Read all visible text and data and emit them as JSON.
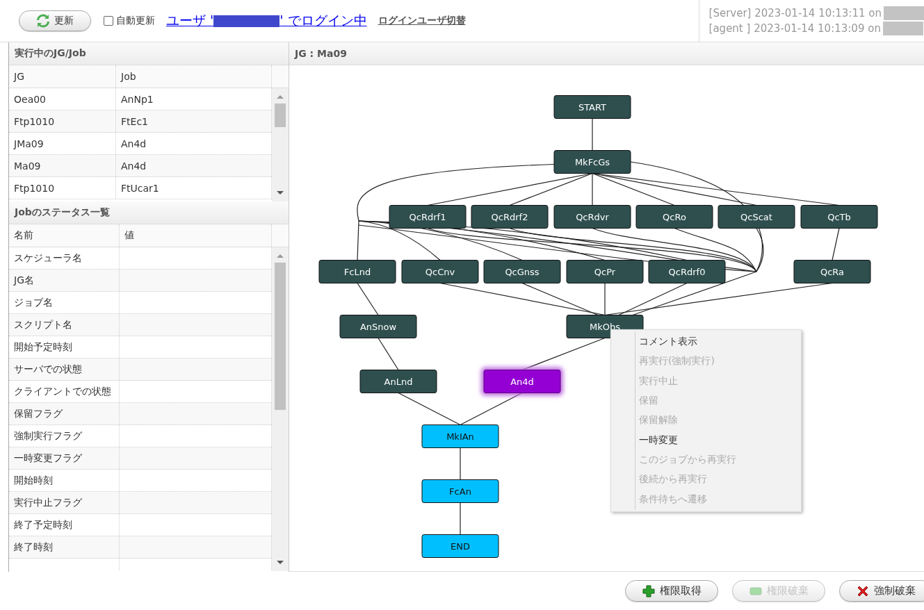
{
  "toolbar": {
    "refresh_button": "更新",
    "auto_refresh": {
      "label": "自動更新",
      "checked": false
    },
    "login_prefix": "ユーザ '",
    "login_suffix": "' でログイン中",
    "switch_user_link": "ログインユーザ切替",
    "server_status": "[Server] 2023-01-14 10:13:11 on",
    "agent_status": "[agent ] 2023-01-14 10:13:09 on"
  },
  "running_panel": {
    "title": "実行中のJG/Job",
    "columns": [
      "JG",
      "Job"
    ],
    "rows": [
      [
        "Oea00",
        "AnNp1"
      ],
      [
        "Ftp1010",
        "FtEc1"
      ],
      [
        "JMa09",
        "An4d"
      ],
      [
        "Ma09",
        "An4d"
      ],
      [
        "Ftp1010",
        "FtUcar1"
      ]
    ]
  },
  "status_panel": {
    "title": "Jobのステータス一覧",
    "columns": [
      "名前",
      "値"
    ],
    "rows": [
      "スケジューラ名",
      "JG名",
      "ジョブ名",
      "スクリプト名",
      "開始予定時刻",
      "サーバでの状態",
      "クライアントでの状態",
      "保留フラグ",
      "強制実行フラグ",
      "一時変更フラグ",
      "開始時刻",
      "実行中止フラグ",
      "終了予定時刻",
      "終了時刻"
    ]
  },
  "graph": {
    "title": "JG : Ma09",
    "nodes": [
      {
        "label": "START",
        "color": "#2f4f4f",
        "selected": false
      },
      {
        "label": "MkFcGs",
        "color": "#2f4f4f",
        "selected": false
      },
      {
        "label": "QcRdrf1",
        "color": "#2f4f4f",
        "selected": false
      },
      {
        "label": "QcRdrf2",
        "color": "#2f4f4f",
        "selected": false
      },
      {
        "label": "QcRdvr",
        "color": "#2f4f4f",
        "selected": false
      },
      {
        "label": "QcRo",
        "color": "#2f4f4f",
        "selected": false
      },
      {
        "label": "QcScat",
        "color": "#2f4f4f",
        "selected": false
      },
      {
        "label": "QcTb",
        "color": "#2f4f4f",
        "selected": false
      },
      {
        "label": "FcLnd",
        "color": "#2f4f4f",
        "selected": false
      },
      {
        "label": "QcCnv",
        "color": "#2f4f4f",
        "selected": false
      },
      {
        "label": "QcGnss",
        "color": "#2f4f4f",
        "selected": false
      },
      {
        "label": "QcPr",
        "color": "#2f4f4f",
        "selected": false
      },
      {
        "label": "QcRdrf0",
        "color": "#2f4f4f",
        "selected": false
      },
      {
        "label": "QcRa",
        "color": "#2f4f4f",
        "selected": false
      },
      {
        "label": "AnSnow",
        "color": "#2f4f4f",
        "selected": false
      },
      {
        "label": "MkObs",
        "color": "#2f4f4f",
        "selected": false
      },
      {
        "label": "AnLnd",
        "color": "#2f4f4f",
        "selected": false
      },
      {
        "label": "An4d",
        "color": "#9400d3",
        "selected": true
      },
      {
        "label": "MkIAn",
        "color": "#00bfff",
        "selected": false
      },
      {
        "label": "FcAn",
        "color": "#00bfff",
        "selected": false
      },
      {
        "label": "END",
        "color": "#00bfff",
        "selected": false
      }
    ]
  },
  "context_menu": [
    {
      "label": "コメント表示",
      "disabled": false
    },
    {
      "label": "再実行(強制実行)",
      "disabled": true
    },
    {
      "label": "実行中止",
      "disabled": true
    },
    {
      "label": "保留",
      "disabled": true
    },
    {
      "label": "保留解除",
      "disabled": true
    },
    {
      "label": "一時変更",
      "disabled": false
    },
    {
      "label": "このジョブから再実行",
      "disabled": true
    },
    {
      "label": "後続から再実行",
      "disabled": true
    },
    {
      "label": "条件待ちへ遷移",
      "disabled": true
    }
  ],
  "buttons": [
    {
      "label": "権限取得",
      "kind": "acquire",
      "disabled": false
    },
    {
      "label": "権限破棄",
      "kind": "release",
      "disabled": true
    },
    {
      "label": "強制破棄",
      "kind": "force",
      "disabled": false
    }
  ]
}
